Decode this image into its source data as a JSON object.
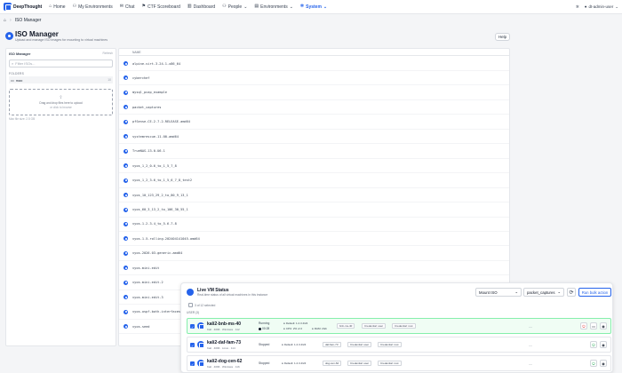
{
  "nav": {
    "brand": "DeepThought",
    "items": [
      {
        "label": "Home",
        "icon": "home-icon",
        "glyph": "⌂"
      },
      {
        "label": "My Environments",
        "icon": "people-icon",
        "glyph": "⚇"
      },
      {
        "label": "Chat",
        "icon": "chat-icon",
        "glyph": "✉"
      },
      {
        "label": "CTF Scoreboard",
        "icon": "flag-icon",
        "glyph": "⚑"
      },
      {
        "label": "Dashboard",
        "icon": "chart-icon",
        "glyph": "▥"
      },
      {
        "label": "People",
        "icon": "people-icon",
        "glyph": "⚇"
      },
      {
        "label": "Environments",
        "icon": "server-icon",
        "glyph": "▤"
      },
      {
        "label": "System",
        "icon": "gear-icon",
        "glyph": "✲"
      }
    ],
    "user": "dt-admin-user"
  },
  "breadcrumb": {
    "current": "ISO Manager"
  },
  "header": {
    "title": "ISO Manager",
    "subtitle": "Upload and manage ISO images for mounting to virtual machines",
    "help": "Help"
  },
  "left": {
    "title": "ISO Manager",
    "refresh": "Refresh",
    "filter_placeholder": "Filter ISOs...",
    "section": "FOLDERS",
    "folder": "max",
    "folder_count": "10",
    "drop_text": "Drag and drop files here to upload",
    "drop_sub": "or click to browse",
    "max_size": "Max file size: 2.5 GB"
  },
  "files": {
    "header": "NAME",
    "items": [
      "alpine-virt-3.24.1-x86_64",
      "cyberchef",
      "mysql_pcap_example",
      "packet_captures",
      "pfSense-CE-2.7.2-RELEASE-amd64",
      "systemrescue-11.00-amd64",
      "TrueNAS-13.0-U6.1",
      "vyos_1_2_0-6_to_1_5_7_8",
      "vyos_1_2_3-6_to_1_5_6_7_8_test2",
      "vyos_10_123_29_2_to_80_9_13_1",
      "vyos_60_3_13_2_to_106_30_55_1",
      "vyos-1.2.3.4_to_5.6.7.8",
      "vyos-1.5-rolling-202404141045-amd64",
      "vyos-2026.03-generic-amd64",
      "vyos-mini-edit",
      "vyos-mini-edit-2",
      "vyos-mini-edit-3",
      "vyos-ospf-both-interfaces",
      "vyos-seed"
    ]
  },
  "vm_panel": {
    "title": "Live VM Status",
    "subtitle": "Real-time status of all virtual machines in this instance",
    "mount_select": "Mount ISO",
    "iso_select": "packet_captures",
    "bulk_button": "Run bulk action",
    "selected": "3 of 12 selected",
    "group": "USER (3)",
    "vms": [
      {
        "name": "kali2-bnb-ms-40",
        "meta": "Kali · 4096 · Windows · 112",
        "status": "Running",
        "time": "00:28",
        "network": "Default: 1.2.3.4/24",
        "cpu": "CPU: 2% of 2",
        "ram": "RAM: 2Gb",
        "tag": "bnb-ms-40",
        "cred1": "Credential: user",
        "cred2": "Credential: root",
        "extra": "—"
      },
      {
        "name": "kali2-daf-fam-73",
        "meta": "Kali · 4096 · Linux · 114",
        "status": "Stopped",
        "network": "Default: 1.2.3.4/24",
        "tag": "daf-fam-73",
        "cred1": "Credential: user",
        "cred2": "Credential: root",
        "extra": "—"
      },
      {
        "name": "kali2-dog-cen-62",
        "meta": "Kali · 4096 · Windows · 116",
        "status": "Stopped",
        "network": "Default: 1.2.3.4/24",
        "tag": "dog-cen-62",
        "cred1": "Credential: user",
        "cred2": "Credential: root",
        "extra": "—"
      }
    ]
  },
  "colors": {
    "accent": "#2563eb",
    "running_bg": "#f0fdf4",
    "running_border": "#86efac"
  }
}
